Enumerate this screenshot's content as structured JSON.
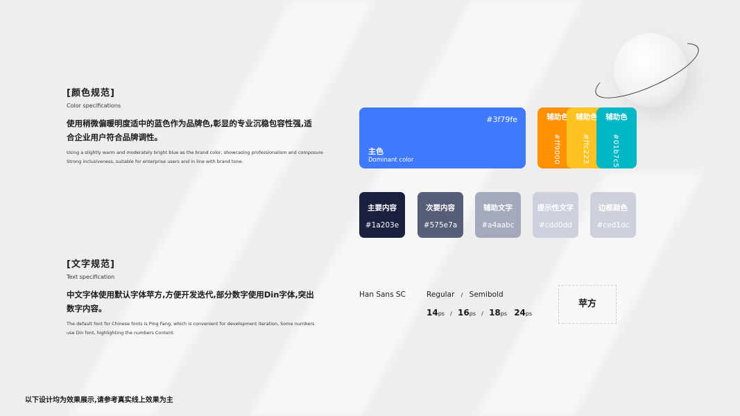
{
  "color_section": {
    "title": "[颜色规范]",
    "subtitle": "Color specifications",
    "desc_cn": "使用稍微偏暖明度适中的蓝色作为品牌色,彰显的专业沉稳包容性强,适合企业用户符合品牌调性。",
    "desc_en": "Using a slightly warm and moderately bright blue as the brand color, showcasing professionalism and composure Strong inclusiveness, suitable for enterprise users and in line with brand tone."
  },
  "main_color": {
    "hex": "#3f79fe",
    "name": "主色",
    "en": "Dominant color",
    "color": "#3f79fe"
  },
  "aux_colors": [
    {
      "label": "辅助色",
      "hex": "#ff9000",
      "color": "#ff9000"
    },
    {
      "label": "辅助色",
      "hex": "#ffc223",
      "color": "#ffc223"
    },
    {
      "label": "辅助色",
      "hex": "#01b7c5",
      "color": "#01b7c5"
    }
  ],
  "text_colors": [
    {
      "label": "主要内容",
      "hex": "#1a203e",
      "color": "#1a203e"
    },
    {
      "label": "次要内容",
      "hex": "#575e7a",
      "color": "#575e7a"
    },
    {
      "label": "辅助文字",
      "hex": "#a4aabc",
      "color": "#a4aabc"
    },
    {
      "label": "提示性文字",
      "hex": "#cdd0dd",
      "color": "#cdd0dd"
    },
    {
      "label": "边框颜色",
      "hex": "#ced1dc",
      "color": "#ced1dc"
    }
  ],
  "text_section": {
    "title": "[文字规范]",
    "subtitle": "Text specification",
    "desc_cn": "中文字体使用默认字体苹方,方便开发迭代,部分数字使用Din字体,突出数字内容。",
    "desc_en": "The default font for Chinese fonts is Ping Fang, which is convenient for development iteration, Some numbers use Din font, highlighting the numbers Content."
  },
  "typography": {
    "font_name": "Han Sans SC",
    "weights": [
      "Regular",
      "Semibold"
    ],
    "weight_sep": "/",
    "sizes": [
      {
        "num": "14",
        "unit": "ps"
      },
      {
        "num": "16",
        "unit": "ps"
      },
      {
        "num": "18",
        "unit": "ps"
      },
      {
        "num": "24",
        "unit": "ps"
      }
    ],
    "size_sep": "/",
    "sample": "苹方"
  },
  "footer": {
    "note": "以下设计均为效果展示,请参考真实线上效果为主"
  }
}
